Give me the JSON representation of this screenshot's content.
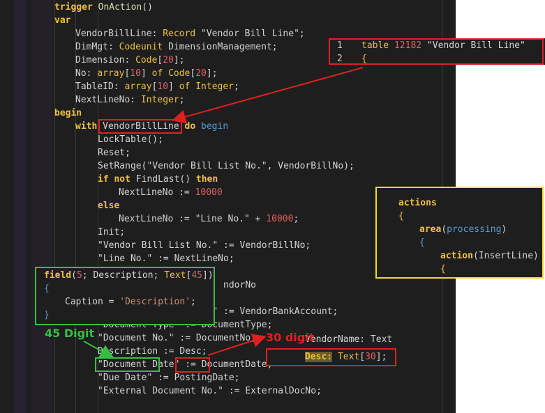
{
  "main_code": [
    {
      "indent": 78,
      "tokens": [
        [
          "kw",
          "trigger"
        ],
        [
          "plain",
          " "
        ],
        [
          "fn",
          "OnAction"
        ],
        [
          "plain",
          "()"
        ]
      ]
    },
    {
      "indent": 78,
      "tokens": [
        [
          "kw",
          "var"
        ]
      ]
    },
    {
      "indent": 108,
      "tokens": [
        [
          "plain",
          "VendorBillLine: "
        ],
        [
          "ty",
          "Record"
        ],
        [
          "plain",
          " \"Vendor Bill Line\";"
        ]
      ]
    },
    {
      "indent": 108,
      "tokens": [
        [
          "plain",
          "DimMgt: "
        ],
        [
          "ty",
          "Codeunit"
        ],
        [
          "plain",
          " DimensionManagement;"
        ]
      ]
    },
    {
      "indent": 108,
      "tokens": [
        [
          "plain",
          "Dimension: "
        ],
        [
          "ty",
          "Code"
        ],
        [
          "plain",
          "["
        ],
        [
          "num",
          "20"
        ],
        [
          "plain",
          "];"
        ]
      ]
    },
    {
      "indent": 108,
      "tokens": [
        [
          "plain",
          "No: "
        ],
        [
          "ty",
          "array"
        ],
        [
          "plain",
          "["
        ],
        [
          "num",
          "10"
        ],
        [
          "plain",
          "] "
        ],
        [
          "ty",
          "of"
        ],
        [
          "plain",
          " "
        ],
        [
          "ty",
          "Code"
        ],
        [
          "plain",
          "["
        ],
        [
          "num",
          "20"
        ],
        [
          "plain",
          "];"
        ]
      ]
    },
    {
      "indent": 108,
      "tokens": [
        [
          "plain",
          "TableID: "
        ],
        [
          "ty",
          "array"
        ],
        [
          "plain",
          "["
        ],
        [
          "num",
          "10"
        ],
        [
          "plain",
          "] "
        ],
        [
          "ty",
          "of"
        ],
        [
          "plain",
          " "
        ],
        [
          "ty",
          "Integer"
        ],
        [
          "plain",
          ";"
        ]
      ]
    },
    {
      "indent": 108,
      "tokens": [
        [
          "plain",
          "NextLineNo: "
        ],
        [
          "ty",
          "Integer"
        ],
        [
          "plain",
          ";"
        ]
      ]
    },
    {
      "indent": 78,
      "tokens": [
        [
          "kw",
          "begin"
        ]
      ]
    },
    {
      "indent": 108,
      "tokens": [
        [
          "kw",
          "with"
        ],
        [
          "plain",
          " VendorBillLine "
        ],
        [
          "kw",
          "do"
        ],
        [
          "plain",
          " "
        ],
        [
          "kw2",
          "begin"
        ]
      ]
    },
    {
      "indent": 140,
      "tokens": [
        [
          "plain",
          "LockTable();"
        ]
      ]
    },
    {
      "indent": 140,
      "tokens": [
        [
          "plain",
          "Reset;"
        ]
      ]
    },
    {
      "indent": 140,
      "tokens": [
        [
          "plain",
          "SetRange(\"Vendor Bill List No.\", VendorBillNo);"
        ]
      ]
    },
    {
      "indent": 140,
      "tokens": [
        [
          "kw",
          "if"
        ],
        [
          "plain",
          " "
        ],
        [
          "kw",
          "not"
        ],
        [
          "plain",
          " FindLast() "
        ],
        [
          "kw",
          "then"
        ]
      ]
    },
    {
      "indent": 170,
      "tokens": [
        [
          "plain",
          "NextLineNo := "
        ],
        [
          "num",
          "10000"
        ]
      ]
    },
    {
      "indent": 140,
      "tokens": [
        [
          "kw",
          "else"
        ]
      ]
    },
    {
      "indent": 170,
      "tokens": [
        [
          "plain",
          "NextLineNo := \"Line No.\" + "
        ],
        [
          "num",
          "10000"
        ],
        [
          "plain",
          ";"
        ]
      ]
    },
    {
      "indent": 140,
      "tokens": [
        [
          "plain",
          "Init;"
        ]
      ]
    },
    {
      "indent": 140,
      "tokens": [
        [
          "plain",
          "\"Vendor Bill List No.\" := VendorBillNo;"
        ]
      ]
    },
    {
      "indent": 140,
      "tokens": [
        [
          "plain",
          "\"Line No.\" := NextLineNo;"
        ]
      ]
    },
    {
      "indent": 140,
      "tokens": [
        [
          "plain",
          ""
        ]
      ]
    },
    {
      "indent": 140,
      "tokens": [
        [
          "plain",
          "                       ndorNo"
        ]
      ]
    },
    {
      "indent": 140,
      "tokens": [
        [
          "plain",
          ""
        ]
      ]
    },
    {
      "indent": 140,
      "tokens": [
        [
          "plain",
          "\"Vendor Bank Acc. No.\" := VendorBankAccount;"
        ]
      ]
    },
    {
      "indent": 140,
      "tokens": [
        [
          "plain",
          "\"Document Type\" := DocumentType;"
        ]
      ]
    },
    {
      "indent": 140,
      "tokens": [
        [
          "plain",
          "\"Document No.\" := DocumentNo;"
        ]
      ]
    },
    {
      "indent": 140,
      "tokens": [
        [
          "plain",
          "Description := Desc;"
        ]
      ]
    },
    {
      "indent": 140,
      "tokens": [
        [
          "plain",
          "\"Document Date\" := DocumentDate;"
        ]
      ]
    },
    {
      "indent": 140,
      "tokens": [
        [
          "plain",
          "\"Due Date\" := PostingDate;"
        ]
      ]
    },
    {
      "indent": 140,
      "tokens": [
        [
          "plain",
          "\"External Document No.\" := ExternalDocNo;"
        ]
      ]
    }
  ],
  "table_panel": {
    "lines": [
      {
        "num": "1",
        "tokens": [
          [
            "ty",
            "table"
          ],
          [
            "plain",
            " "
          ],
          [
            "num",
            "12182"
          ],
          [
            "plain",
            " \"Vendor Bill Line\""
          ]
        ]
      },
      {
        "num": "2",
        "tokens": [
          [
            "ty",
            "{"
          ]
        ]
      }
    ]
  },
  "actions_panel": {
    "lines": [
      {
        "indent": 0,
        "tokens": [
          [
            "kw",
            "actions"
          ]
        ]
      },
      {
        "indent": 0,
        "tokens": [
          [
            "ty",
            "{"
          ]
        ]
      },
      {
        "indent": 30,
        "tokens": [
          [
            "kw",
            "area"
          ],
          [
            "plain",
            "("
          ],
          [
            "kw2",
            "processing"
          ],
          [
            "plain",
            ")"
          ]
        ]
      },
      {
        "indent": 30,
        "tokens": [
          [
            "kw2",
            "{"
          ]
        ]
      },
      {
        "indent": 60,
        "tokens": [
          [
            "kw",
            "action"
          ],
          [
            "plain",
            "(InsertLine)"
          ]
        ]
      },
      {
        "indent": 60,
        "tokens": [
          [
            "ty",
            "{"
          ]
        ]
      }
    ]
  },
  "field_panel": {
    "lines": [
      {
        "indent": 0,
        "tokens": [
          [
            "kw",
            "field"
          ],
          [
            "plain",
            "("
          ],
          [
            "num",
            "5"
          ],
          [
            "plain",
            "; Description; "
          ],
          [
            "ty",
            "Text"
          ],
          [
            "plain",
            "["
          ],
          [
            "num",
            "45"
          ],
          [
            "plain",
            "])"
          ]
        ]
      },
      {
        "indent": 0,
        "tokens": [
          [
            "kw2",
            "{"
          ]
        ]
      },
      {
        "indent": 30,
        "tokens": [
          [
            "plain",
            "Caption = "
          ],
          [
            "str",
            "'Description'"
          ],
          [
            "plain",
            ";"
          ]
        ]
      },
      {
        "indent": 0,
        "tokens": [
          [
            "kw2",
            "}"
          ]
        ]
      }
    ]
  },
  "desc_panel": {
    "partial_above": "VendorName: Text",
    "lines": [
      {
        "tokens": [
          [
            "hl",
            "Desc:"
          ],
          [
            "plain",
            " "
          ],
          [
            "ty",
            "Text"
          ],
          [
            "plain",
            "["
          ],
          [
            "num",
            "30"
          ],
          [
            "plain",
            "];"
          ]
        ]
      }
    ]
  },
  "annotations": {
    "green_label": "45 Digit",
    "red_label": "30 digit"
  },
  "colors": {
    "red": "#e02020",
    "green": "#35c040",
    "yellow": "#f0e020"
  }
}
